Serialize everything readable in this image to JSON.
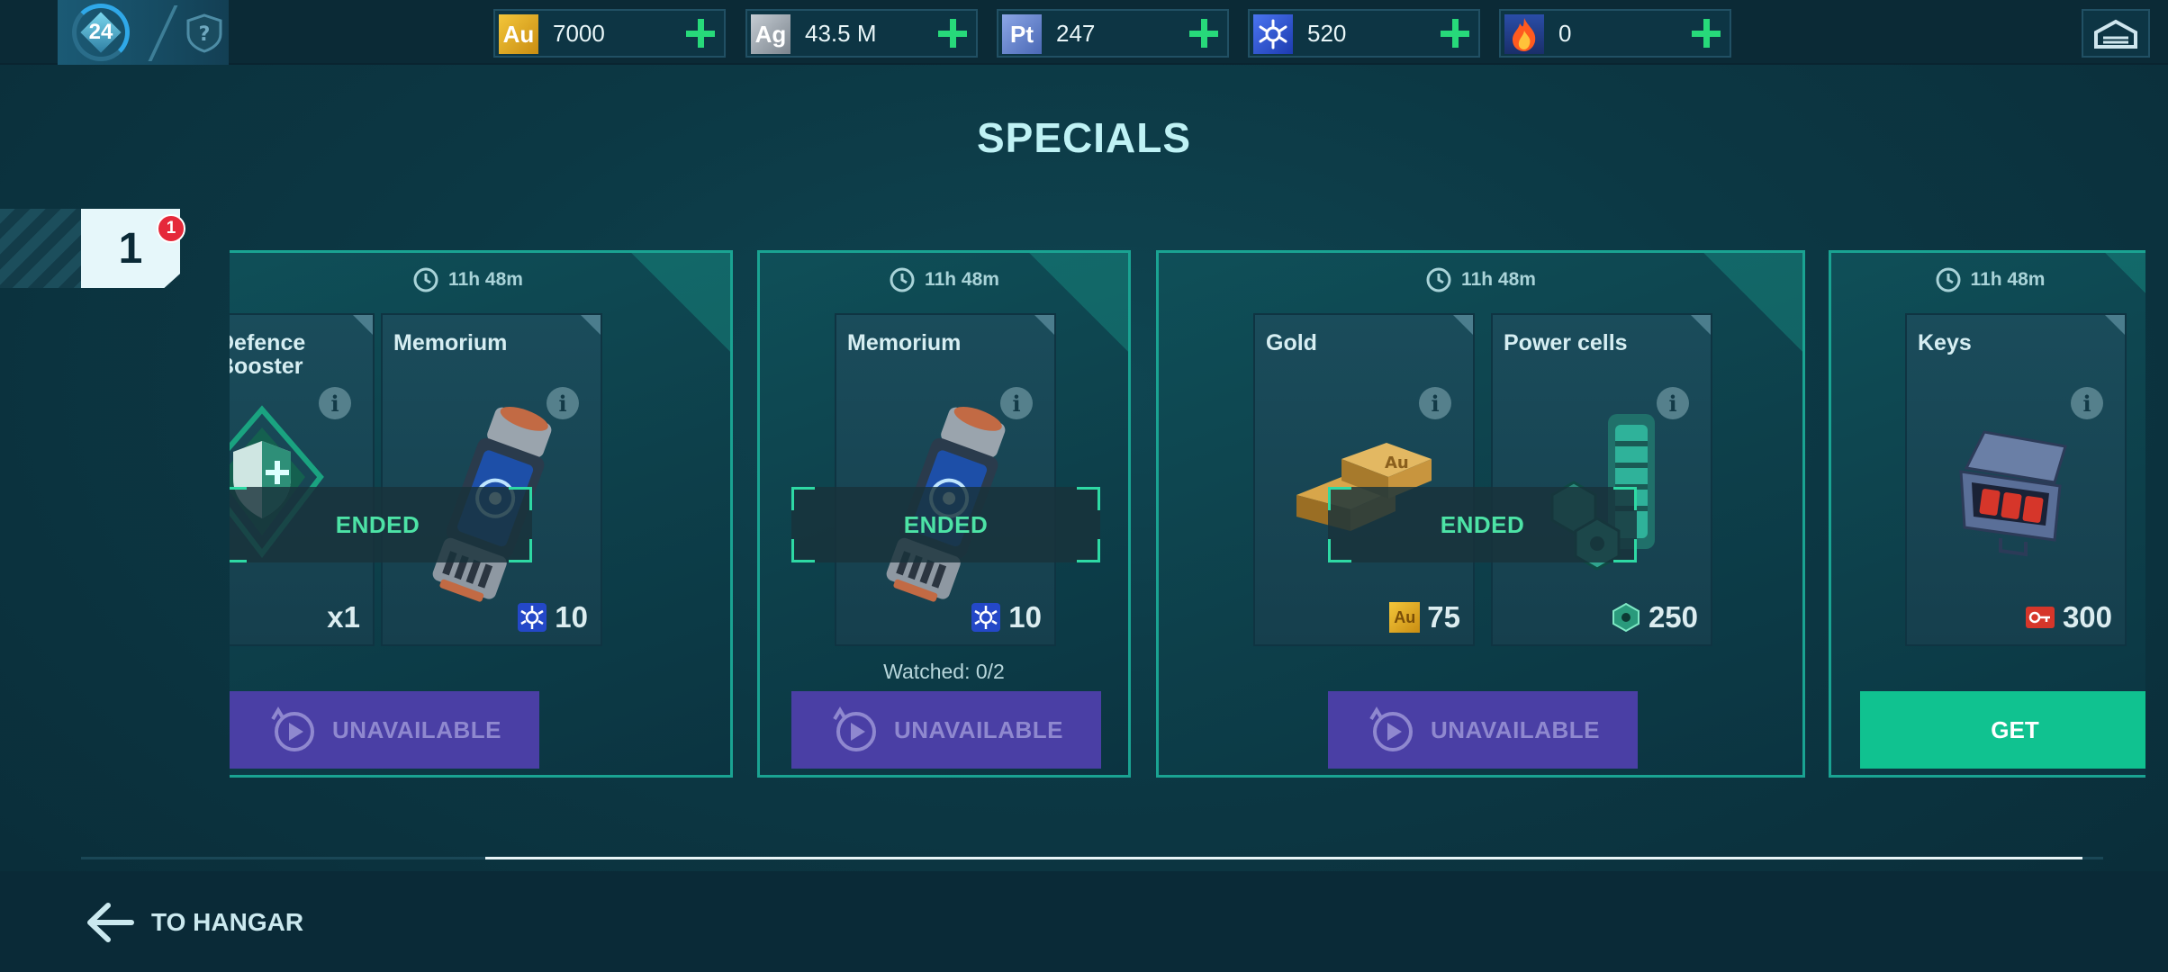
{
  "header": {
    "level": "24",
    "resources": [
      {
        "symbol": "Au",
        "value": "7000",
        "color": "#e0a81d"
      },
      {
        "symbol": "Ag",
        "value": "43.5 M",
        "color": "#9aa3ad"
      },
      {
        "symbol": "Pt",
        "value": "247",
        "color": "#5d7fc8"
      },
      {
        "symbol": "",
        "value": "520",
        "color": "#2f56d6",
        "icon": "memorium-icon"
      },
      {
        "symbol": "",
        "value": "0",
        "color": "#e04a1c",
        "icon": "flame-icon"
      }
    ]
  },
  "title": "SPECIALS",
  "pager": {
    "page": "1",
    "badge": "1"
  },
  "offers": [
    {
      "timer": "11h 48m",
      "items": [
        {
          "name_line1": "Defence",
          "name_line2": "Booster",
          "amount": "x1"
        },
        {
          "name": "Memorium",
          "amount": "10"
        }
      ],
      "status": "ENDED",
      "button": "UNAVAILABLE"
    },
    {
      "timer": "11h 48m",
      "items": [
        {
          "name": "Memorium",
          "amount": "10"
        }
      ],
      "status": "ENDED",
      "watched": "Watched: 0/2",
      "button": "UNAVAILABLE"
    },
    {
      "timer": "11h 48m",
      "items": [
        {
          "name": "Gold",
          "amount": "75",
          "currency": "Au"
        },
        {
          "name": "Power cells",
          "amount": "250"
        }
      ],
      "status": "ENDED",
      "button": "UNAVAILABLE"
    },
    {
      "timer": "11h 48m",
      "items": [
        {
          "name": "Keys",
          "amount": "300"
        }
      ],
      "button": "GET"
    }
  ],
  "scroll": {
    "position": 0.2,
    "visible_fraction": 0.79
  },
  "footer": {
    "back_label": "TO HANGAR"
  }
}
